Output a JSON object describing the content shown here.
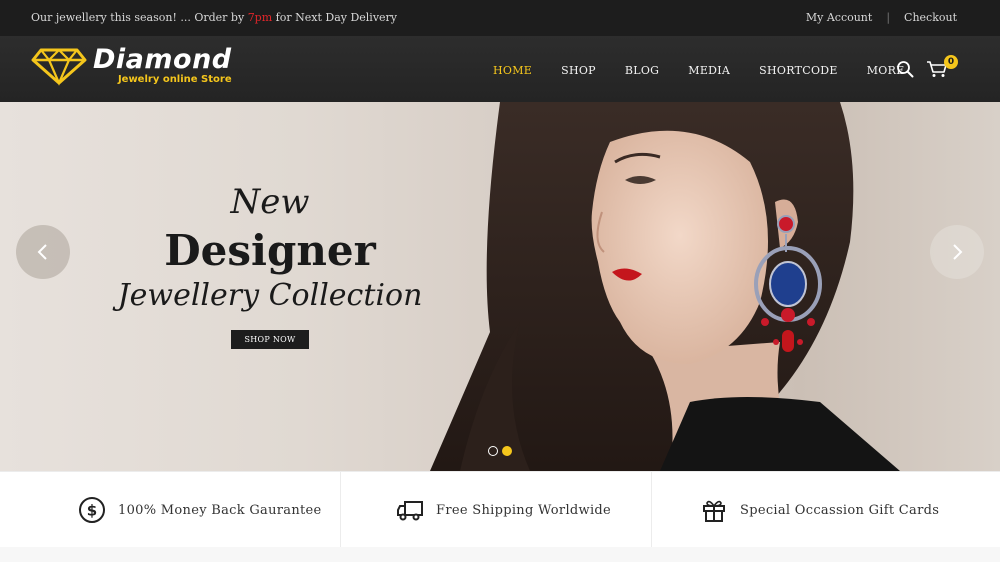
{
  "topbar": {
    "promo_before": "Our jewellery this season! ... Order by ",
    "promo_highlight": "7pm",
    "promo_after": " for Next Day Delivery",
    "my_account": "My Account",
    "separator": "|",
    "checkout": "Checkout"
  },
  "brand": {
    "name": "Diamond",
    "tagline": "Jewelry online Store",
    "accent_color": "#f5c61c"
  },
  "nav": {
    "items": [
      {
        "label": "HOME",
        "active": true
      },
      {
        "label": "SHOP",
        "active": false
      },
      {
        "label": "BLOG",
        "active": false
      },
      {
        "label": "MEDIA",
        "active": false
      },
      {
        "label": "SHORTCODE",
        "active": false
      },
      {
        "label": "MORE",
        "active": false
      }
    ],
    "search_icon": "search-icon",
    "cart_icon": "cart-icon",
    "cart_count": "0"
  },
  "hero": {
    "line1": "New",
    "line2": "Designer",
    "line3": "Jewellery Collection",
    "button": "SHOP NOW",
    "prev_icon": "chevron-left-icon",
    "next_icon": "chevron-right-icon",
    "slides_total": 2,
    "active_slide": 2
  },
  "features": [
    {
      "icon": "dollar-icon",
      "label": "100% Money Back Gaurantee"
    },
    {
      "icon": "truck-icon",
      "label": "Free Shipping Worldwide"
    },
    {
      "icon": "gift-icon",
      "label": "Special Occassion Gift Cards"
    }
  ]
}
